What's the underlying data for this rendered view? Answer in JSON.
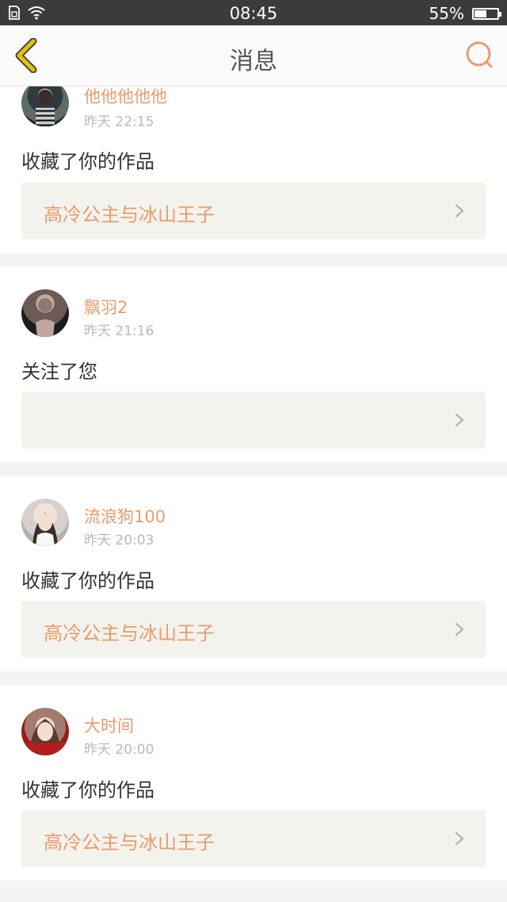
{
  "status_bar": {
    "time": "08:45",
    "battery_text": "55%",
    "battery_level": 0.55
  },
  "nav": {
    "title": "消息",
    "accent_color": "#eb9b6b",
    "back_color": "#d9b800"
  },
  "messages": [
    {
      "user": "他他他他他",
      "time": "昨天 22:15",
      "action": "收藏了你的作品",
      "work": "高冷公主与冰山王子"
    },
    {
      "user": "飘羽2",
      "time": "昨天 21:16",
      "action": "关注了您",
      "work": ""
    },
    {
      "user": "流浪狗100",
      "time": "昨天 20:03",
      "action": "收藏了你的作品",
      "work": "高冷公主与冰山王子"
    },
    {
      "user": "大时间",
      "time": "昨天 20:00",
      "action": "收藏了你的作品",
      "work": "高冷公主与冰山王子"
    }
  ]
}
